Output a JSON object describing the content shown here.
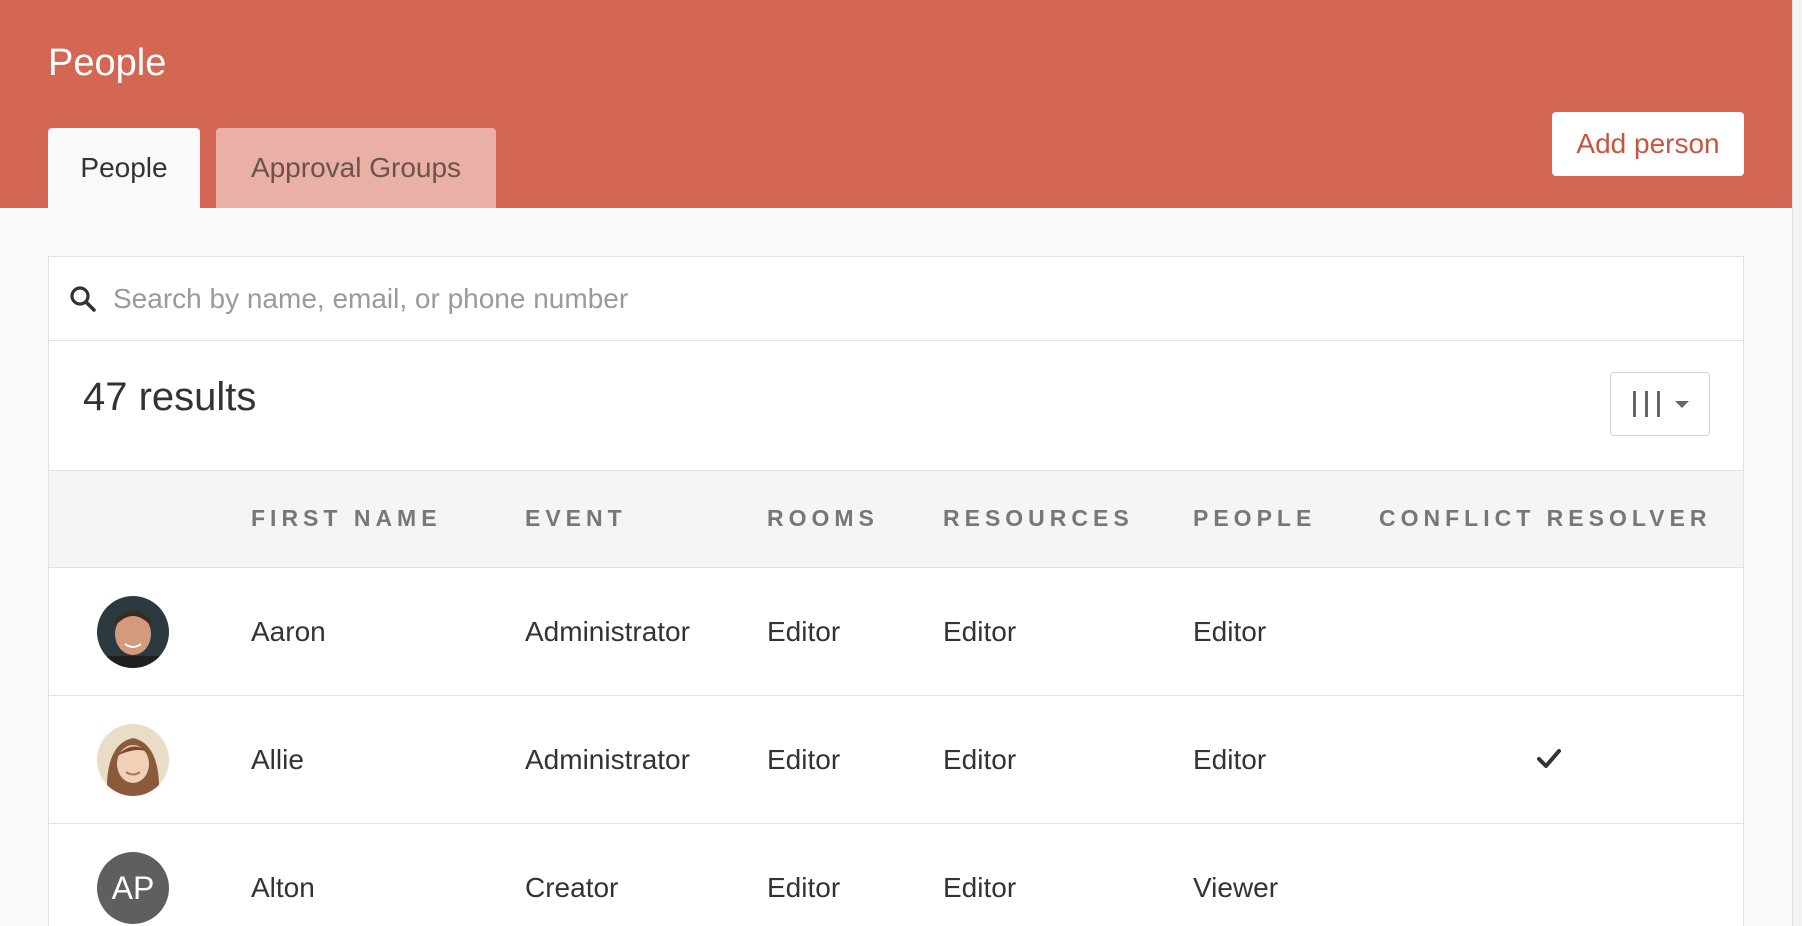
{
  "header": {
    "title": "People",
    "tabs": [
      {
        "label": "People",
        "active": true
      },
      {
        "label": "Approval Groups",
        "active": false
      }
    ],
    "add_button": "Add person"
  },
  "search": {
    "placeholder": "Search by name, email, or phone number",
    "value": ""
  },
  "results": {
    "count_label": "47 results"
  },
  "columns_button": {
    "icon": "column-toggle-icon"
  },
  "table": {
    "headers": [
      "FIRST NAME",
      "EVENT",
      "ROOMS",
      "RESOURCES",
      "PEOPLE",
      "CONFLICT RESOLVER"
    ],
    "rows": [
      {
        "avatar": "photo",
        "initials": "",
        "first_name": "Aaron",
        "event": "Administrator",
        "rooms": "Editor",
        "resources": "Editor",
        "people": "Editor",
        "conflict_resolver": false
      },
      {
        "avatar": "photo",
        "initials": "",
        "first_name": "Allie",
        "event": "Administrator",
        "rooms": "Editor",
        "resources": "Editor",
        "people": "Editor",
        "conflict_resolver": true
      },
      {
        "avatar": "initials",
        "initials": "AP",
        "first_name": "Alton",
        "event": "Creator",
        "rooms": "Editor",
        "resources": "Editor",
        "people": "Viewer",
        "conflict_resolver": false
      }
    ]
  },
  "colors": {
    "brand": "#d36753",
    "brand_tab_inactive": "#ebb0a5",
    "button_text": "#c8553f"
  }
}
